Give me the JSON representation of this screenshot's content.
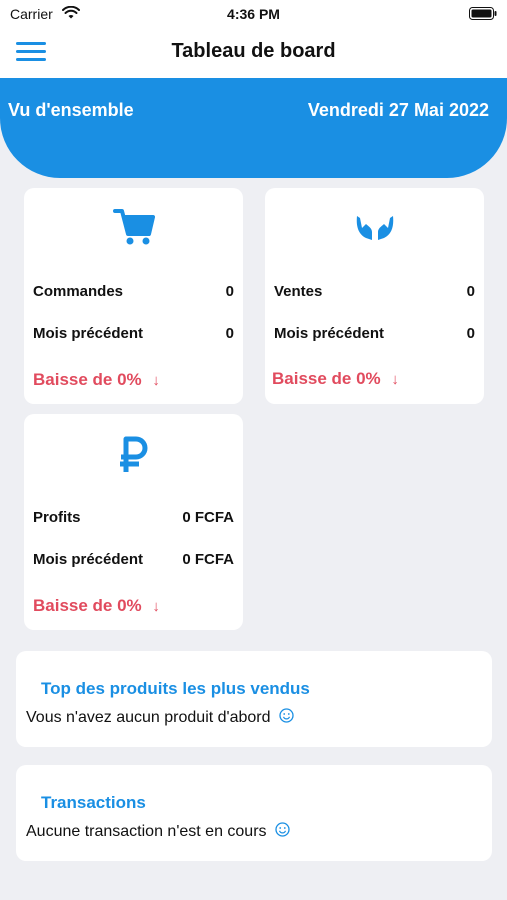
{
  "status_bar": {
    "carrier": "Carrier",
    "time": "4:36 PM"
  },
  "header": {
    "title": "Tableau de board"
  },
  "hero": {
    "left_label": "Vu d'ensemble",
    "date": "Vendredi 27 Mai 2022"
  },
  "cards": {
    "orders": {
      "label": "Commandes",
      "value": "0",
      "prev_label": "Mois précédent",
      "prev_value": "0",
      "trend": "Baisse de 0%"
    },
    "sales": {
      "label": "Ventes",
      "value": "0",
      "prev_label": "Mois précédent",
      "prev_value": "0",
      "trend": "Baisse de 0%"
    },
    "profits": {
      "label": "Profits",
      "value": "0 FCFA",
      "prev_label": "Mois précédent",
      "prev_value": "0 FCFA",
      "trend": "Baisse de 0%"
    }
  },
  "top_products": {
    "title": "Top des produits les plus vendus",
    "message": "Vous n'avez aucun produit d'abord"
  },
  "transactions": {
    "title": "Transactions",
    "message": "Aucune transaction n'est en cours"
  },
  "colors": {
    "accent": "#1a8fe3",
    "negative": "#e14b5e",
    "background": "#eeeff3"
  },
  "icons": [
    "menu-icon",
    "cart-icon",
    "hands-icon",
    "ruble-icon",
    "arrow-down-icon",
    "smile-icon",
    "wifi-icon",
    "battery-icon"
  ]
}
